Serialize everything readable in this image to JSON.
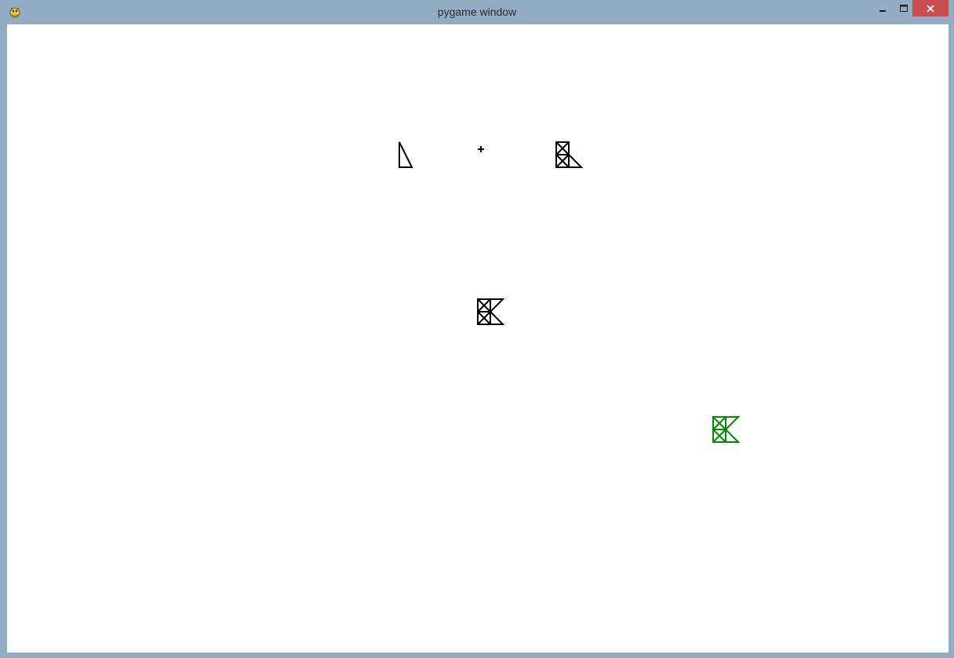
{
  "window": {
    "title": "pygame window",
    "app_icon": "pygame-snake-icon",
    "controls": {
      "minimize_icon": "minimize-icon",
      "maximize_icon": "maximize-icon",
      "close_icon": "close-icon"
    }
  },
  "colors": {
    "frame": "#92adc3",
    "client_bg": "#ffffff",
    "close_button": "#c7504f",
    "glyph_black": "#000000",
    "glyph_green": "#008800"
  },
  "canvas": {
    "glyphs": [
      {
        "name": "glyph-l-shape",
        "color": "#000000"
      },
      {
        "name": "crosshair",
        "color": "#000000"
      },
      {
        "name": "glyph-stack-upper",
        "color": "#000000"
      },
      {
        "name": "glyph-stack-center",
        "color": "#000000"
      },
      {
        "name": "glyph-stack-green",
        "color": "#008800"
      }
    ]
  }
}
